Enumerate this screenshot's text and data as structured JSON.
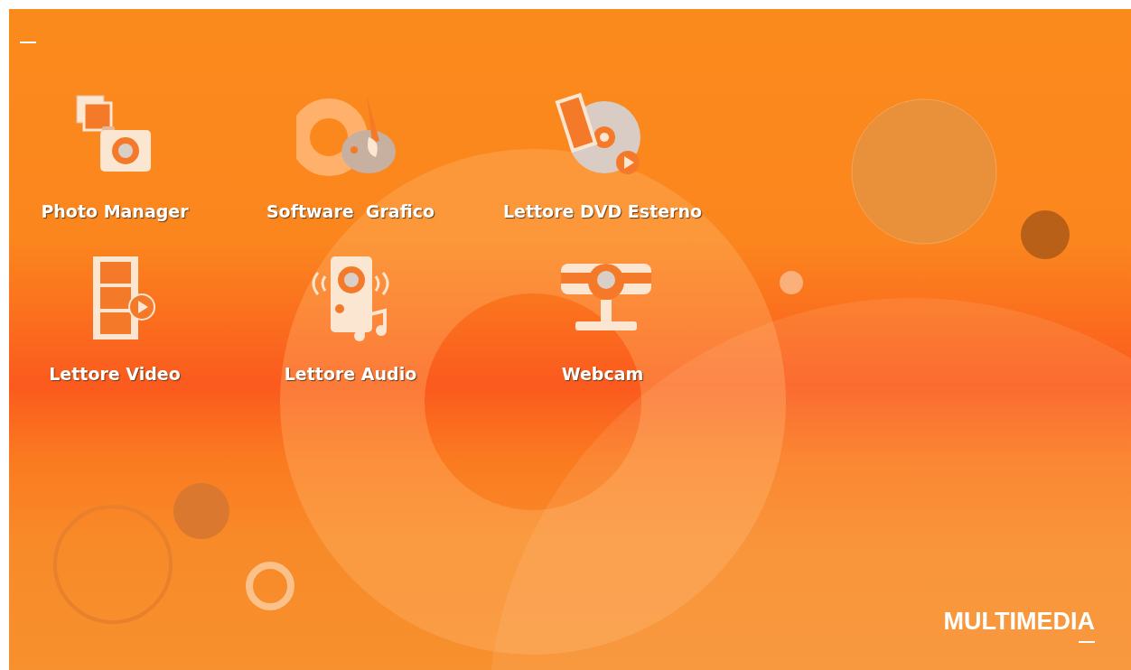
{
  "apps": [
    {
      "label": "Photo Manager",
      "kind": "photo"
    },
    {
      "label": "Software  Grafico",
      "kind": "graphics"
    },
    {
      "label": "Lettore DVD Esterno",
      "kind": "dvd"
    },
    {
      "label": "Lettore Video",
      "kind": "video"
    },
    {
      "label": "Lettore Audio",
      "kind": "audio"
    },
    {
      "label": "Webcam",
      "kind": "webcam"
    }
  ],
  "section_title": "MULTIMEDIA"
}
